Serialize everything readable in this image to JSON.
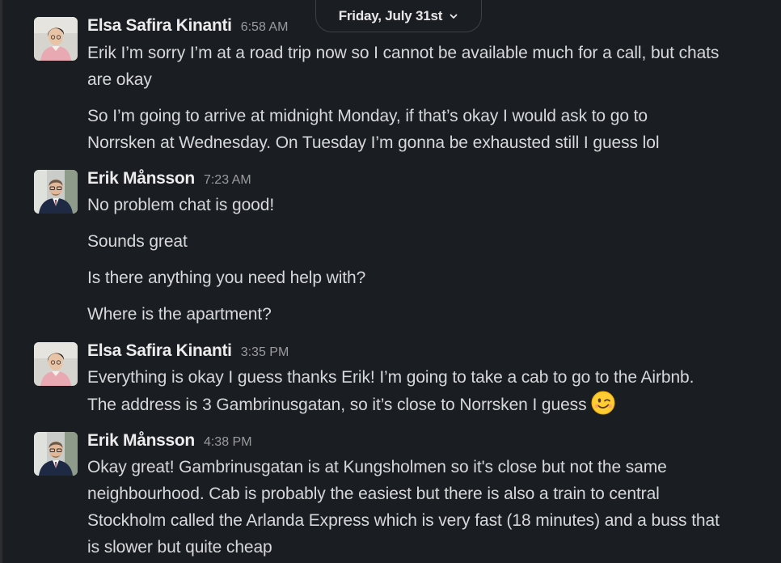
{
  "date_divider": {
    "label": "Friday, July 31st",
    "chevron_icon": "chevron-down-icon"
  },
  "messages": [
    {
      "sender": "Elsa Safira Kinanti",
      "time": "6:58 AM",
      "avatar_icon": "avatar-elsa",
      "lines": [
        "Erik I’m sorry I’m at a road trip now so I cannot be available much for a call, but chats",
        "are okay",
        "So I’m going to arrive at midnight Monday, if that’s okay I would ask to go to",
        "Norrsken at Wednesday. On Tuesday I’m gonna be exhausted still I guess lol"
      ]
    },
    {
      "sender": "Erik Månsson",
      "time": "7:23 AM",
      "avatar_icon": "avatar-erik",
      "lines": [
        "No problem chat is good!",
        "Sounds great",
        "Is there anything you need help with?",
        "Where is the apartment?"
      ]
    },
    {
      "sender": "Elsa Safira Kinanti",
      "time": "3:35 PM",
      "avatar_icon": "avatar-elsa",
      "lines": [
        "Everything is okay I guess thanks Erik! I’m going to take a cab to go to the Airbnb.",
        "The address is 3 Gambrinusgatan, so it’s close to Norrsken I guess"
      ],
      "emoji_icon": "winking-face-emoji"
    },
    {
      "sender": "Erik Månsson",
      "time": "4:38 PM",
      "avatar_icon": "avatar-erik",
      "lines": [
        "Okay great! Gambrinusgatan is at Kungsholmen so it's close but not the same",
        "neighbourhood. Cab is probably the easiest but there is also a train to central",
        "Stockholm called the Arlanda Express which is very fast (18 minutes) and a buss that",
        "is slower but quite cheap"
      ]
    }
  ],
  "colors": {
    "background": "#1a1d21",
    "text": "#d7d8d9",
    "sender": "#ececec",
    "timestamp": "#9a9b9d"
  }
}
